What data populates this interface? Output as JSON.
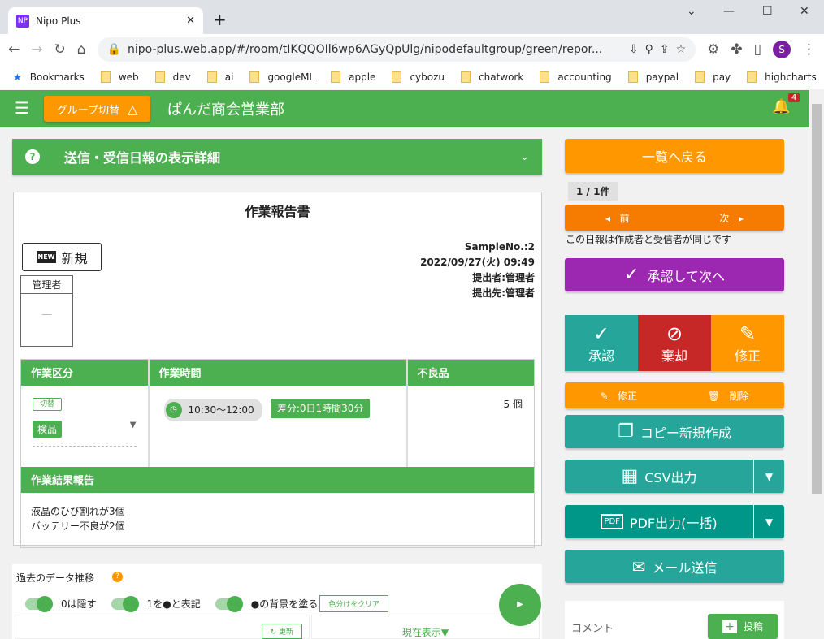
{
  "browser": {
    "tab_title": "Nipo Plus",
    "favicon": "NP",
    "url": "nipo-plus.web.app/#/room/tIKQQOIl6wp6AGyQpUlg/nipodefaultgroup/green/repor...",
    "avatar": "S",
    "bookmarks": [
      "Bookmarks",
      "web",
      "dev",
      "ai",
      "googleML",
      "apple",
      "cybozu",
      "chatwork",
      "accounting",
      "paypal",
      "pay",
      "highcharts"
    ]
  },
  "app": {
    "group_switch": "グループ切替",
    "title": "ぱんだ商会営業部",
    "badge": "4",
    "accent": "#4caf50"
  },
  "section": {
    "title": "送信・受信日報の表示詳細"
  },
  "report": {
    "title": "作業報告書",
    "new_label": "新規",
    "new_icon": "NEW",
    "approver": "管理者",
    "approver_mark": "—",
    "sample_no": "SampleNo.:2",
    "datetime": "2022/09/27(火) 09:49",
    "submitter": "提出者:管理者",
    "recipient": "提出先:管理者",
    "columns": [
      "作業区分",
      "作業時間",
      "不良品"
    ],
    "switch_label": "切替",
    "category": "検品",
    "time_range": "10:30～12:00",
    "diff": "差分:0日1時間30分",
    "defects": "5 個",
    "result_header": "作業結果報告",
    "result_lines": [
      "液晶のひび割れが3個",
      "バッテリー不良が2個"
    ]
  },
  "history": {
    "title": "過去のデータ推移",
    "help": "?",
    "toggles": [
      "0は隠す",
      "1を●と表記",
      "●の背景を塗る"
    ],
    "clear_colors": "色分けをクリア",
    "refresh": "更新",
    "current_view": "現在表示▼"
  },
  "side": {
    "back": "一覧へ戻る",
    "count": "1 / 1件",
    "prev": "前",
    "next": "次",
    "notice": "この日報は作成者と受信者が同じです",
    "approve_next": "承認して次へ",
    "approve": "承認",
    "reject": "棄却",
    "revise": "修正",
    "edit": "修正",
    "delete": "削除",
    "copy": "コピー新規作成",
    "csv": "CSV出力",
    "pdf": "PDF出力(一括)",
    "mail": "メール送信",
    "comment": "コメント",
    "post": "投稿"
  }
}
